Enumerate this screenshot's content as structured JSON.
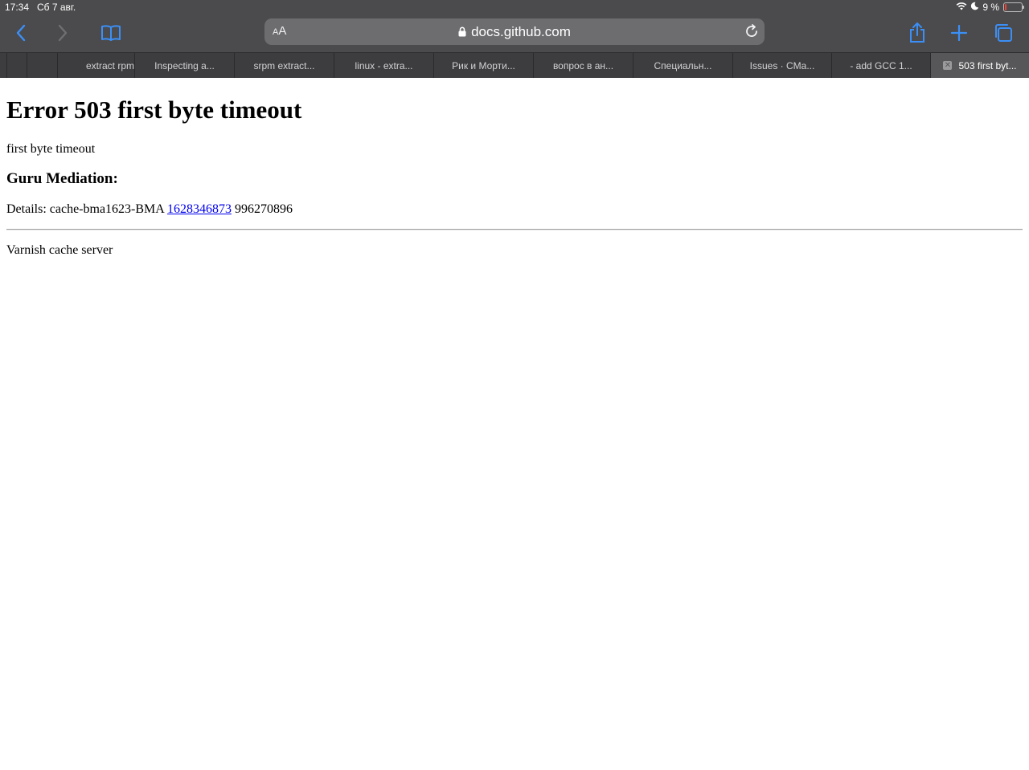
{
  "status_bar": {
    "time": "17:34",
    "date": "Сб 7 авг.",
    "battery_text": "9 %",
    "battery_level_percent": 9
  },
  "toolbar": {
    "aa_small": "A",
    "aa_large": "A",
    "url": "docs.github.com",
    "accent_color": "#3b8ff7"
  },
  "tabs": [
    {
      "label": "extract rpm"
    },
    {
      "label": "Inspecting a..."
    },
    {
      "label": "srpm extract..."
    },
    {
      "label": "linux - extra..."
    },
    {
      "label": "Рик и Морти..."
    },
    {
      "label": "вопрос в ан..."
    },
    {
      "label": "Специальн..."
    },
    {
      "label": "Issues · CMa..."
    },
    {
      "label": "- add GCC 1..."
    },
    {
      "label": "503 first byt..."
    }
  ],
  "page": {
    "heading": "Error 503 first byte timeout",
    "subtitle": "first byte timeout",
    "section_heading": "Guru Mediation:",
    "details_prefix": "Details: cache-bma1623-BMA",
    "details_link": "1628346873",
    "details_suffix": "996270896",
    "footer": "Varnish cache server"
  }
}
